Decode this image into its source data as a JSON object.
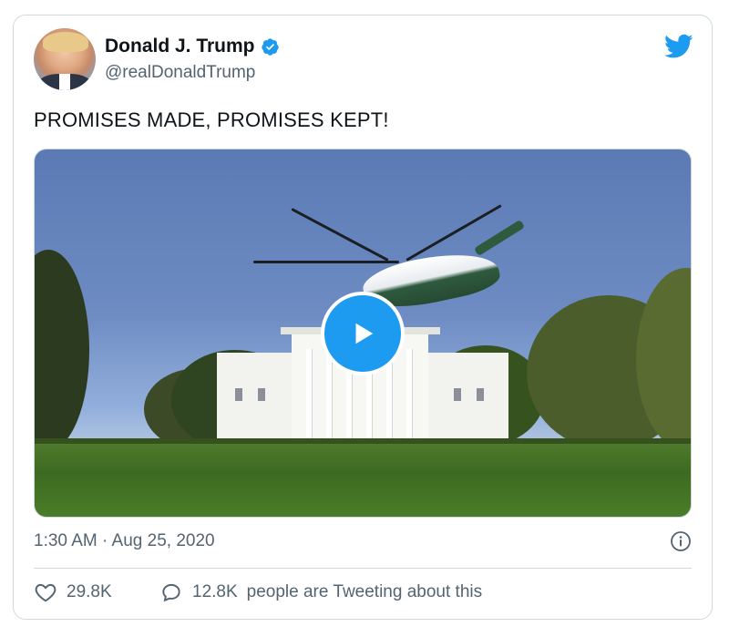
{
  "author": {
    "display_name": "Donald J. Trump",
    "handle": "@realDonaldTrump",
    "verified": true
  },
  "tweet": {
    "text": "PROMISES MADE, PROMISES KEPT!",
    "timestamp": "1:30 AM · Aug 25, 2020"
  },
  "stats": {
    "likes": "29.8K",
    "tweeting_count": "12.8K",
    "tweeting_label": "people are Tweeting about this"
  },
  "icons": {
    "brand": "twitter-bird-icon",
    "verified": "verified-badge-icon",
    "play": "play-icon",
    "info": "info-icon",
    "like": "heart-icon",
    "reply": "speech-bubble-icon"
  },
  "colors": {
    "accent": "#1d9bf0",
    "text": "#0f1419",
    "muted": "#536471",
    "border": "#cfd9de"
  }
}
